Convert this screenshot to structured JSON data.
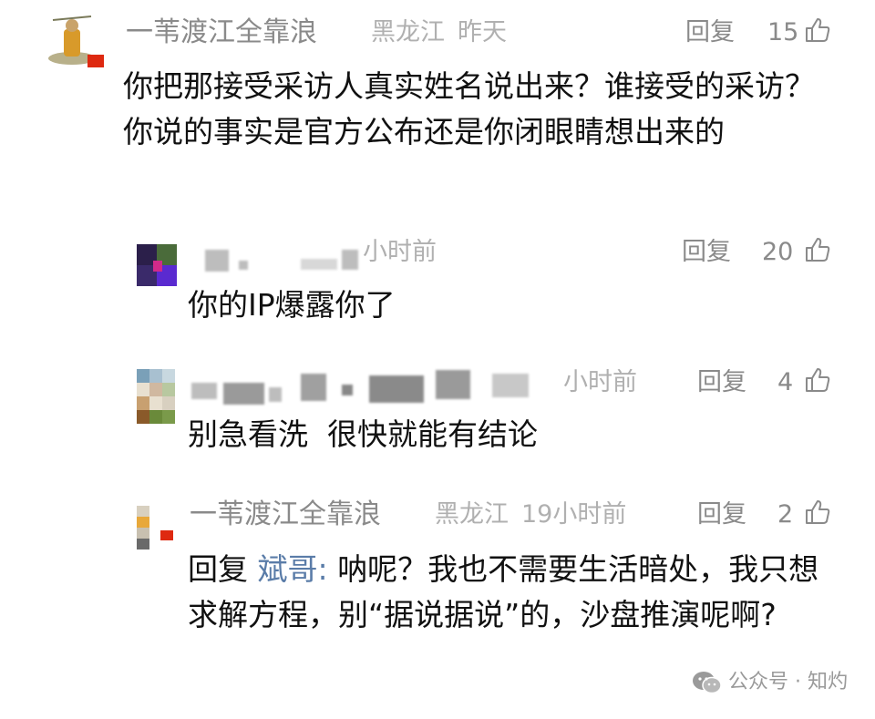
{
  "colors": {
    "like_icon": "#8a8a8a",
    "mention": "#5a7ca8"
  },
  "comments": [
    {
      "name": "一苇渡江全靠浪",
      "location": "黑龙江",
      "time": "昨天",
      "reply_label": "回复",
      "likes": "15",
      "text": "你把那接受采访人真实姓名说出来？谁接受的采访？你说的事实是官方公布还是你闭眼睛想出来的"
    },
    {
      "name": "",
      "time": "小时前",
      "reply_label": "回复",
      "likes": "20",
      "text": "你的IP爆露你了"
    },
    {
      "name": "",
      "time": "小时前",
      "reply_label": "回复",
      "likes": "4",
      "text": "别急看洗  很快就能有结论"
    },
    {
      "name": "一苇渡江全靠浪",
      "location": "黑龙江",
      "time": "19小时前",
      "reply_label": "回复",
      "likes": "2",
      "reply_prefix": "回复",
      "mention": "斌哥",
      "colon": ":",
      "text": "呐呢？我也不需要生活暗处，我只想求解方程，别“据说据说”的，沙盘推演呢啊?"
    }
  ],
  "watermark": {
    "icon": "wechat-icon",
    "text": "公众号 · 知灼"
  }
}
